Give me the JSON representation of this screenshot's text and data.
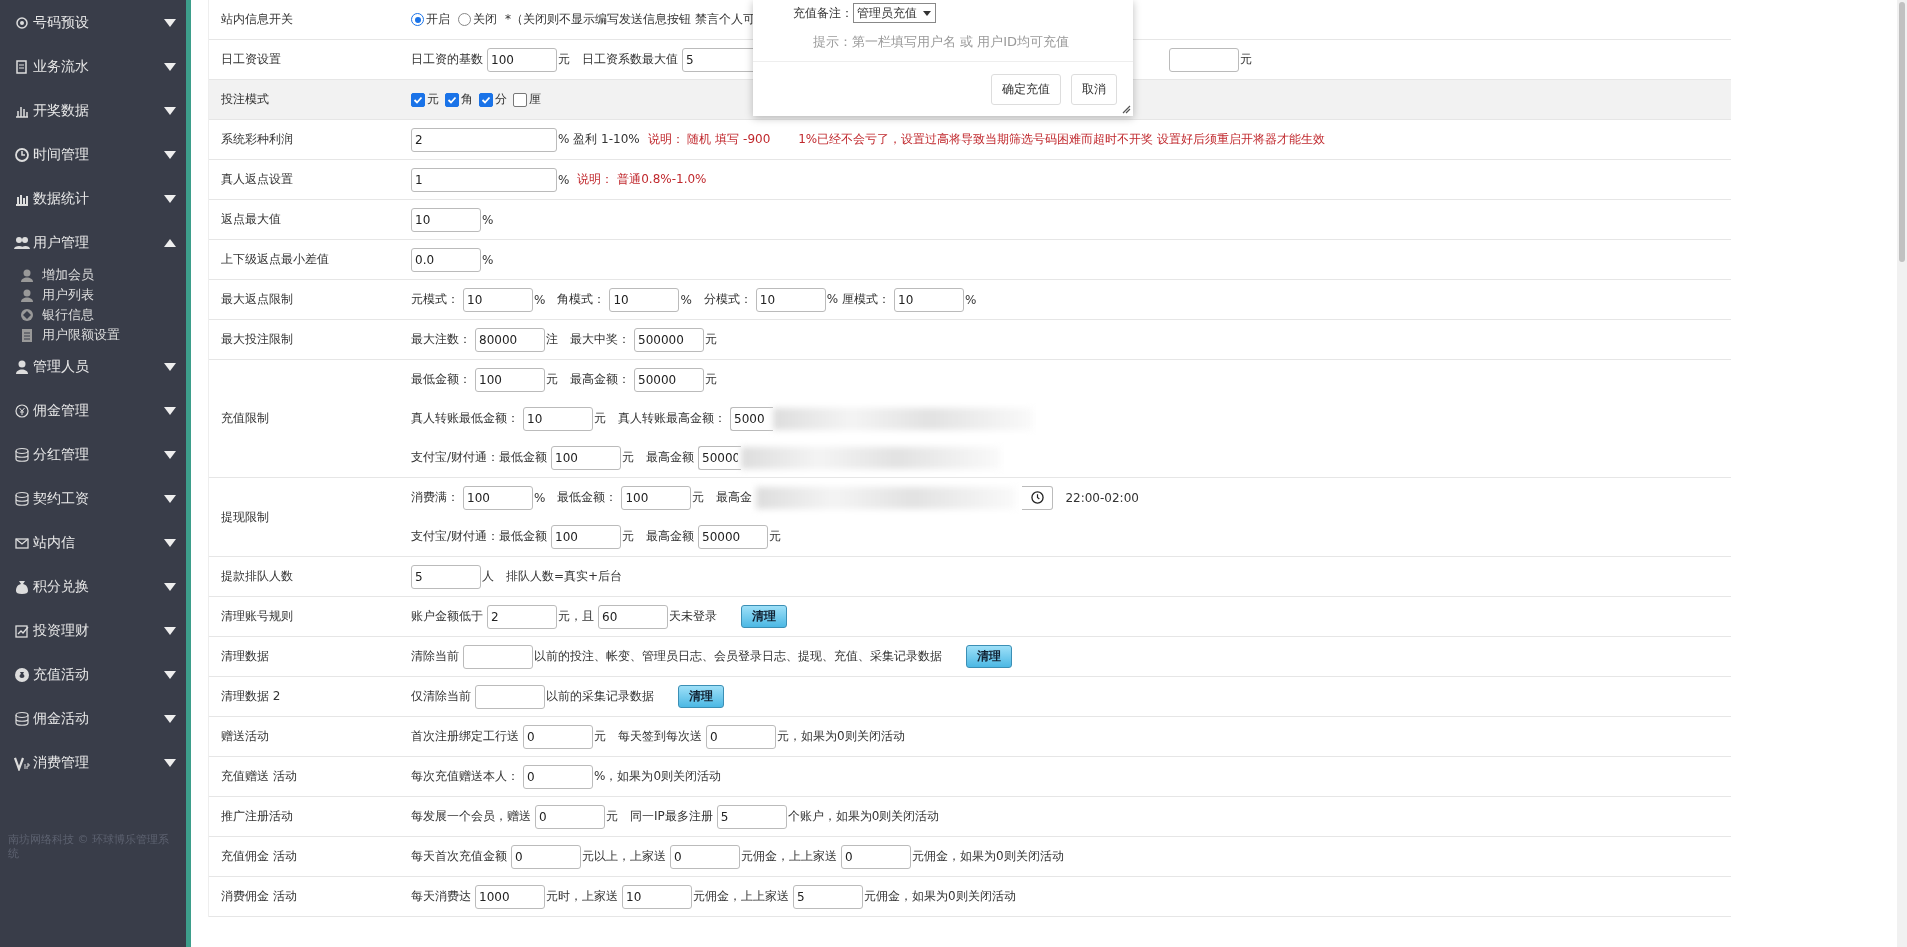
{
  "sidebar": {
    "items": [
      {
        "label": "号码预设",
        "expanded": false
      },
      {
        "label": "业务流水",
        "expanded": false
      },
      {
        "label": "开奖数据",
        "expanded": false
      },
      {
        "label": "时间管理",
        "expanded": false
      },
      {
        "label": "数据统计",
        "expanded": false
      },
      {
        "label": "用户管理",
        "expanded": true,
        "children": [
          {
            "label": "增加会员"
          },
          {
            "label": "用户列表"
          },
          {
            "label": "银行信息"
          },
          {
            "label": "用户限额设置"
          }
        ]
      },
      {
        "label": "管理人员",
        "expanded": false
      },
      {
        "label": "佣金管理",
        "expanded": false
      },
      {
        "label": "分红管理",
        "expanded": false
      },
      {
        "label": "契约工资",
        "expanded": false
      },
      {
        "label": "站内信",
        "expanded": false
      },
      {
        "label": "积分兑换",
        "expanded": false
      },
      {
        "label": "投资理财",
        "expanded": false
      },
      {
        "label": "充值活动",
        "expanded": false
      },
      {
        "label": "佣金活动",
        "expanded": false
      },
      {
        "label": "消费管理",
        "expanded": false
      }
    ],
    "footer": "南坊网络科技 © 环球博乐管理系统"
  },
  "form": {
    "rows": [
      {
        "label": "站内信息开关",
        "shaded": false,
        "lines": [
          [
            {
              "kind": "radio",
              "text": "开启",
              "checked": true
            },
            {
              "kind": "radio",
              "text": "关闭",
              "checked": false
            },
            {
              "kind": "text",
              "text": "*（关闭则不显示编写发送信息按钮 禁言个人可"
            }
          ]
        ]
      },
      {
        "label": "日工资设置",
        "shaded": false,
        "lines": [
          [
            {
              "kind": "text",
              "text": "日工资的基数"
            },
            {
              "kind": "input",
              "value": "100"
            },
            {
              "kind": "text",
              "text": "元"
            },
            {
              "kind": "text",
              "text": "日工资系数最大值"
            },
            {
              "kind": "wide_input",
              "value": "5"
            },
            {
              "kind": "hidden"
            },
            {
              "kind": "input"
            },
            {
              "kind": "text",
              "text": "元"
            }
          ]
        ]
      },
      {
        "label": "投注模式",
        "shaded": true,
        "lines": [
          [
            {
              "kind": "checkbox",
              "text": "元",
              "checked": true
            },
            {
              "kind": "checkbox",
              "text": "角",
              "checked": true
            },
            {
              "kind": "checkbox",
              "text": "分",
              "checked": true
            },
            {
              "kind": "checkbox",
              "text": "厘",
              "checked": false
            }
          ]
        ]
      },
      {
        "label": "系统彩种利润",
        "shaded": false,
        "lines": [
          [
            {
              "kind": "wide_input",
              "value": "2"
            },
            {
              "kind": "text",
              "text": "% 盈利 1-10%"
            },
            {
              "kind": "note",
              "text": "说明： 随机 填写 -900　　 1%已经不会亏了，设置过高将导致当期筛选号码困难而超时不开奖 设置好后须重启开将器才能生效"
            }
          ]
        ]
      },
      {
        "label": "真人返点设置",
        "shaded": false,
        "lines": [
          [
            {
              "kind": "wide_input",
              "value": "1"
            },
            {
              "kind": "text",
              "text": "%"
            },
            {
              "kind": "note",
              "text": "说明： 普通0.8%-1.0%"
            }
          ]
        ]
      },
      {
        "label": "返点最大值",
        "shaded": false,
        "lines": [
          [
            {
              "kind": "input",
              "value": "10"
            },
            {
              "kind": "text",
              "text": "%"
            }
          ]
        ]
      },
      {
        "label": "上下级返点最小差值",
        "shaded": false,
        "lines": [
          [
            {
              "kind": "input",
              "value": "0.0"
            },
            {
              "kind": "text",
              "text": "%"
            }
          ]
        ]
      },
      {
        "label": "最大返点限制",
        "shaded": false,
        "lines": [
          [
            {
              "kind": "text",
              "text": "元模式："
            },
            {
              "kind": "input",
              "value": "10"
            },
            {
              "kind": "text",
              "text": "%"
            },
            {
              "kind": "text",
              "text": "角模式："
            },
            {
              "kind": "input",
              "value": "10"
            },
            {
              "kind": "text",
              "text": "%"
            },
            {
              "kind": "text",
              "text": "分模式："
            },
            {
              "kind": "input",
              "value": "10"
            },
            {
              "kind": "text",
              "text": "% 厘模式："
            },
            {
              "kind": "input",
              "value": "10"
            },
            {
              "kind": "text",
              "text": "%"
            }
          ]
        ]
      },
      {
        "label": "最大投注限制",
        "shaded": false,
        "lines": [
          [
            {
              "kind": "text",
              "text": "最大注数："
            },
            {
              "kind": "input",
              "value": "80000"
            },
            {
              "kind": "text",
              "text": "注"
            },
            {
              "kind": "text",
              "text": "最大中奖："
            },
            {
              "kind": "input",
              "value": "500000"
            },
            {
              "kind": "text",
              "text": "元"
            }
          ]
        ]
      },
      {
        "label": "充值限制",
        "shaded": false,
        "lines": [
          [
            {
              "kind": "text",
              "text": "最低金额："
            },
            {
              "kind": "input",
              "value": "100"
            },
            {
              "kind": "text",
              "text": "元"
            },
            {
              "kind": "text",
              "text": "最高金额："
            },
            {
              "kind": "input",
              "value": "50000"
            },
            {
              "kind": "text",
              "text": "元"
            }
          ],
          [
            {
              "kind": "text",
              "text": "真人转账最低金额："
            },
            {
              "kind": "input",
              "value": "10"
            },
            {
              "kind": "text",
              "text": "元"
            },
            {
              "kind": "text",
              "text": "真人转账最高金额："
            },
            {
              "kind": "short_input",
              "value": "5000"
            },
            {
              "kind": "blur"
            }
          ],
          [
            {
              "kind": "text",
              "text": "支付宝/财付通：最低金额"
            },
            {
              "kind": "input",
              "value": "100"
            },
            {
              "kind": "text",
              "text": "元"
            },
            {
              "kind": "text",
              "text": "最高金额"
            },
            {
              "kind": "short_input",
              "value": "50000"
            },
            {
              "kind": "blur"
            }
          ]
        ]
      },
      {
        "label": "提现限制",
        "shaded": false,
        "lines": [
          [
            {
              "kind": "text",
              "text": "消费满："
            },
            {
              "kind": "input",
              "value": "100"
            },
            {
              "kind": "text",
              "text": "%"
            },
            {
              "kind": "text",
              "text": "最低金额："
            },
            {
              "kind": "input",
              "value": "100"
            },
            {
              "kind": "text",
              "text": "元"
            },
            {
              "kind": "text",
              "text": "最高金"
            },
            {
              "kind": "blur"
            },
            {
              "kind": "time"
            },
            {
              "kind": "text",
              "text": "22:00-02:00"
            }
          ],
          [
            {
              "kind": "text",
              "text": "支付宝/财付通：最低金额"
            },
            {
              "kind": "input",
              "value": "100"
            },
            {
              "kind": "text",
              "text": "元"
            },
            {
              "kind": "text",
              "text": "最高金额"
            },
            {
              "kind": "input",
              "value": "50000"
            },
            {
              "kind": "text",
              "text": "元"
            }
          ]
        ]
      },
      {
        "label": "提款排队人数",
        "shaded": false,
        "lines": [
          [
            {
              "kind": "input",
              "value": "5"
            },
            {
              "kind": "text",
              "text": "人"
            },
            {
              "kind": "text",
              "text": "排队人数=真实+后台"
            }
          ]
        ]
      },
      {
        "label": "清理账号规则",
        "shaded": false,
        "lines": [
          [
            {
              "kind": "text",
              "text": "账户金额低于"
            },
            {
              "kind": "input",
              "value": "2"
            },
            {
              "kind": "text",
              "text": "元，且"
            },
            {
              "kind": "input",
              "value": "60"
            },
            {
              "kind": "text",
              "text": "天未登录"
            },
            {
              "kind": "button",
              "text": "清理"
            }
          ]
        ]
      },
      {
        "label": "清理数据",
        "shaded": false,
        "lines": [
          [
            {
              "kind": "text",
              "text": "清除当前"
            },
            {
              "kind": "input"
            },
            {
              "kind": "text",
              "text": "以前的投注、帐变、管理员日志、会员登录日志、提现、充值、采集记录数据"
            },
            {
              "kind": "button",
              "text": "清理"
            }
          ]
        ]
      },
      {
        "label": "清理数据 2",
        "shaded": false,
        "lines": [
          [
            {
              "kind": "text",
              "text": "仅清除当前"
            },
            {
              "kind": "input"
            },
            {
              "kind": "text",
              "text": "以前的采集记录数据"
            },
            {
              "kind": "button",
              "text": "清理"
            }
          ]
        ]
      },
      {
        "label": "赠送活动",
        "shaded": false,
        "lines": [
          [
            {
              "kind": "text",
              "text": "首次注册绑定工行送"
            },
            {
              "kind": "input",
              "value": "0"
            },
            {
              "kind": "text",
              "text": "元"
            },
            {
              "kind": "text",
              "text": "每天签到每次送"
            },
            {
              "kind": "input",
              "value": "0"
            },
            {
              "kind": "text",
              "text": "元，如果为0则关闭活动"
            }
          ]
        ]
      },
      {
        "label": "充值赠送 活动",
        "shaded": false,
        "lines": [
          [
            {
              "kind": "text",
              "text": "每次充值赠送本人："
            },
            {
              "kind": "input",
              "value": "0"
            },
            {
              "kind": "text",
              "text": "%，如果为0则关闭活动"
            }
          ]
        ]
      },
      {
        "label": "推广注册活动",
        "shaded": false,
        "lines": [
          [
            {
              "kind": "text",
              "text": "每发展一个会员，赠送"
            },
            {
              "kind": "input",
              "value": "0"
            },
            {
              "kind": "text",
              "text": "元"
            },
            {
              "kind": "text",
              "text": "同一IP最多注册"
            },
            {
              "kind": "input",
              "value": "5"
            },
            {
              "kind": "text",
              "text": "个账户，如果为0则关闭活动"
            }
          ]
        ]
      },
      {
        "label": "充值佣金 活动",
        "shaded": false,
        "lines": [
          [
            {
              "kind": "text",
              "text": "每天首次充值金额"
            },
            {
              "kind": "input",
              "value": "0"
            },
            {
              "kind": "text",
              "text": "元以上，上家送"
            },
            {
              "kind": "input",
              "value": "0"
            },
            {
              "kind": "text",
              "text": "元佣金，上上家送"
            },
            {
              "kind": "input",
              "value": "0"
            },
            {
              "kind": "text",
              "text": "元佣金，如果为0则关闭活动"
            }
          ]
        ]
      },
      {
        "label": "消费佣金 活动",
        "shaded": false,
        "lines": [
          [
            {
              "kind": "text",
              "text": "每天消费达"
            },
            {
              "kind": "input",
              "value": "1000"
            },
            {
              "kind": "text",
              "text": "元时，上家送"
            },
            {
              "kind": "input",
              "value": "10"
            },
            {
              "kind": "text",
              "text": "元佣金，上上家送"
            },
            {
              "kind": "input",
              "value": "5"
            },
            {
              "kind": "text",
              "text": "元佣金，如果为0则关闭活动"
            }
          ]
        ]
      }
    ]
  },
  "dialog": {
    "remark_label": "充值备注：",
    "remark_value": "管理员充值",
    "hint": "提示：第一栏填写用户名 或 用户ID均可充值",
    "buttons": [
      "确定充值",
      "取消"
    ]
  }
}
